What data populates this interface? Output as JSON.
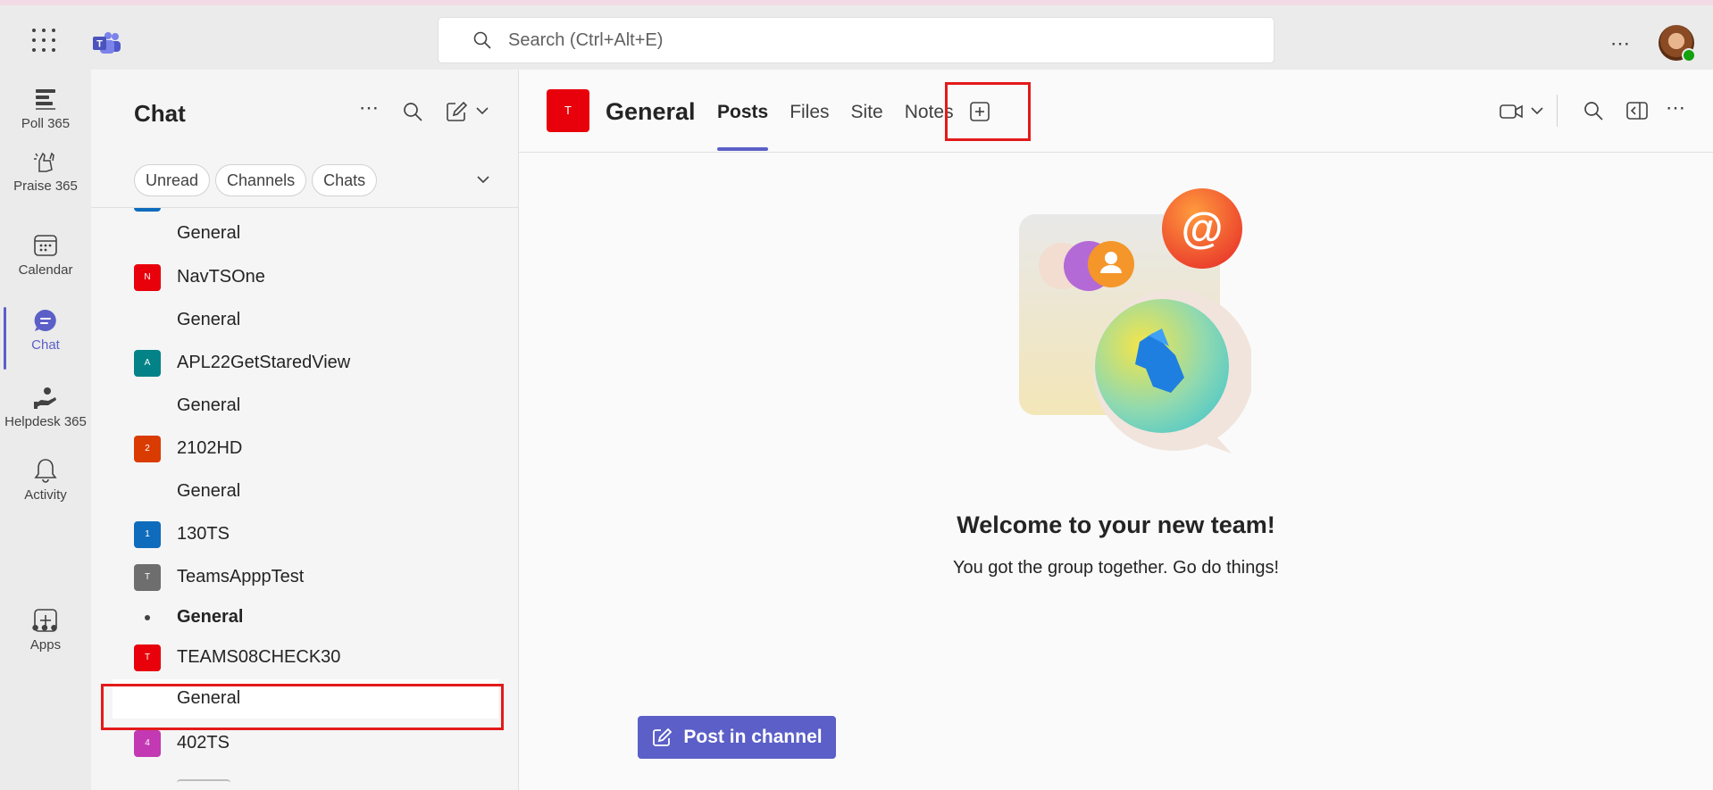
{
  "topbar": {
    "search_placeholder": "Search (Ctrl+Alt+E)",
    "more_label": "⋯"
  },
  "rail": {
    "items": [
      {
        "label": "Poll 365",
        "icon": "poll-icon"
      },
      {
        "label": "Praise 365",
        "icon": "praise-icon"
      },
      {
        "label": "Calendar",
        "icon": "calendar-icon"
      },
      {
        "label": "Chat",
        "icon": "chat-icon",
        "active": true
      },
      {
        "label": "Helpdesk 365",
        "icon": "helpdesk-icon"
      },
      {
        "label": "Activity",
        "icon": "bell-icon"
      },
      {
        "label": "Apps",
        "icon": "add-app-icon"
      }
    ],
    "more_label": "•••"
  },
  "panel": {
    "title": "Chat",
    "more_label": "⋯",
    "filters": [
      "Unread",
      "Channels",
      "Chats"
    ],
    "list": [
      {
        "type": "channel",
        "name": "General"
      },
      {
        "type": "team",
        "name": "NavTSOne",
        "initial": "N",
        "color": "#e8000b"
      },
      {
        "type": "channel",
        "name": "General"
      },
      {
        "type": "team",
        "name": "APL22GetStaredView",
        "initial": "A",
        "color": "#038387"
      },
      {
        "type": "channel",
        "name": "General"
      },
      {
        "type": "team",
        "name": "2102HD",
        "initial": "2",
        "color": "#da3b01"
      },
      {
        "type": "channel",
        "name": "General"
      },
      {
        "type": "team",
        "name": "130TS",
        "initial": "1",
        "color": "#0f6cbd"
      },
      {
        "type": "team",
        "name": "TeamsApppTest",
        "initial": "T",
        "color": "#6e6e6e"
      },
      {
        "type": "channel",
        "name": "General",
        "unread": true
      },
      {
        "type": "team",
        "name": "TEAMS08CHECK30",
        "initial": "T",
        "color": "#e8000b"
      },
      {
        "type": "channel",
        "name": "General",
        "selected": true
      },
      {
        "type": "team",
        "name": "402TS",
        "initial": "4",
        "color": "#c239b3"
      }
    ]
  },
  "channel": {
    "initial": "T",
    "name": "General",
    "tabs": [
      "Posts",
      "Files",
      "Site",
      "Notes"
    ],
    "active_tab": "Posts",
    "more_label": "⋯"
  },
  "welcome": {
    "title": "Welcome to your new team!",
    "subtitle": "You got the group together. Go do things!"
  },
  "post_button": {
    "label": "Post in channel"
  },
  "colors": {
    "accent": "#5b5fc7",
    "highlight_box": "#e31a1a"
  }
}
